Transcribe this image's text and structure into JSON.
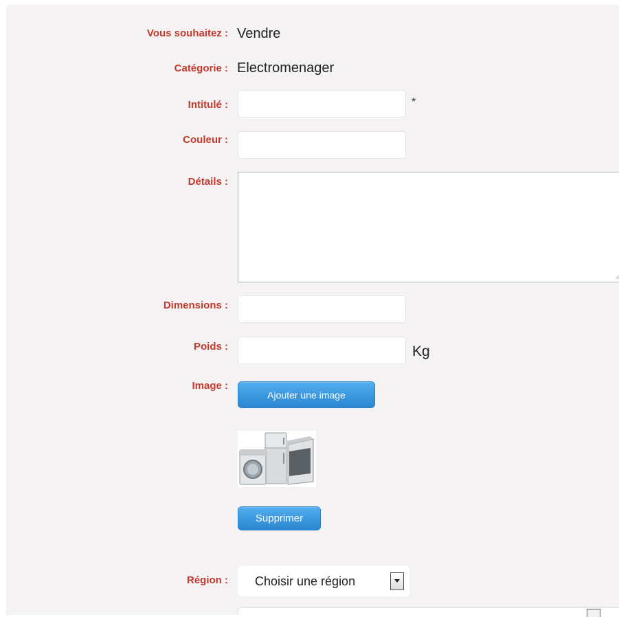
{
  "form": {
    "type_label": "Vous souhaitez :",
    "type_value": "Vendre",
    "category_label": "Catégorie :",
    "category_value": "Electromenager",
    "title_label": "Intitulé :",
    "title_value": "",
    "required_mark": "*",
    "color_label": "Couleur :",
    "color_value": "",
    "details_label": "Détails :",
    "details_value": "",
    "dimensions_label": "Dimensions :",
    "dimensions_value": "",
    "weight_label": "Poids :",
    "weight_value": "",
    "weight_unit": "Kg",
    "image_label": "Image :",
    "add_image_button": "Ajouter une image",
    "image_icon": "home-appliances-thumbnail",
    "delete_button": "Supprimer",
    "region_label": "Région :",
    "region_selected": "Choisir une région"
  },
  "colors": {
    "label": "#c4392d",
    "panel_background": "#f4f2f2",
    "button": "#2a86cf"
  }
}
